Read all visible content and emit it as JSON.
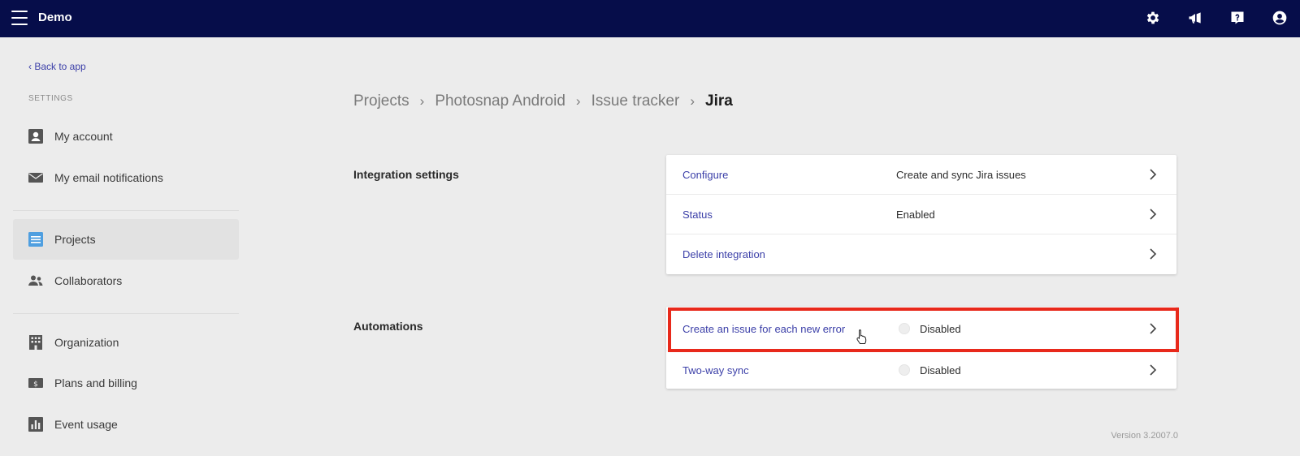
{
  "topbar": {
    "title": "Demo",
    "icons": [
      "menu-icon",
      "gear-icon",
      "megaphone-icon",
      "help-icon",
      "user-icon"
    ]
  },
  "sidebar": {
    "back_link": "‹ Back to app",
    "section_label": "SETTINGS",
    "items": [
      {
        "label": "My account",
        "icon": "account-icon"
      },
      {
        "label": "My email notifications",
        "icon": "mail-icon"
      },
      {
        "label": "Projects",
        "icon": "projects-icon",
        "active": true
      },
      {
        "label": "Collaborators",
        "icon": "collaborators-icon"
      },
      {
        "label": "Organization",
        "icon": "building-icon"
      },
      {
        "label": "Plans and billing",
        "icon": "billing-icon"
      },
      {
        "label": "Event usage",
        "icon": "bar-chart-icon"
      }
    ]
  },
  "breadcrumb": {
    "items": [
      "Projects",
      "Photosnap Android",
      "Issue tracker"
    ],
    "current": "Jira",
    "separator": "›"
  },
  "integration_settings": {
    "title": "Integration settings",
    "rows": [
      {
        "label": "Configure",
        "value": "Create and sync Jira issues"
      },
      {
        "label": "Status",
        "value": "Enabled"
      },
      {
        "label": "Delete integration",
        "value": ""
      }
    ]
  },
  "automations": {
    "title": "Automations",
    "rows": [
      {
        "label": "Create an issue for each new error",
        "value": "Disabled"
      },
      {
        "label": "Two-way sync",
        "value": "Disabled"
      }
    ]
  },
  "footer": {
    "version": "Version 3.2007.0"
  },
  "colors": {
    "topbar": "#060d4a",
    "link": "#3b3fa8",
    "highlight": "#e8291b",
    "background": "#ececec"
  }
}
